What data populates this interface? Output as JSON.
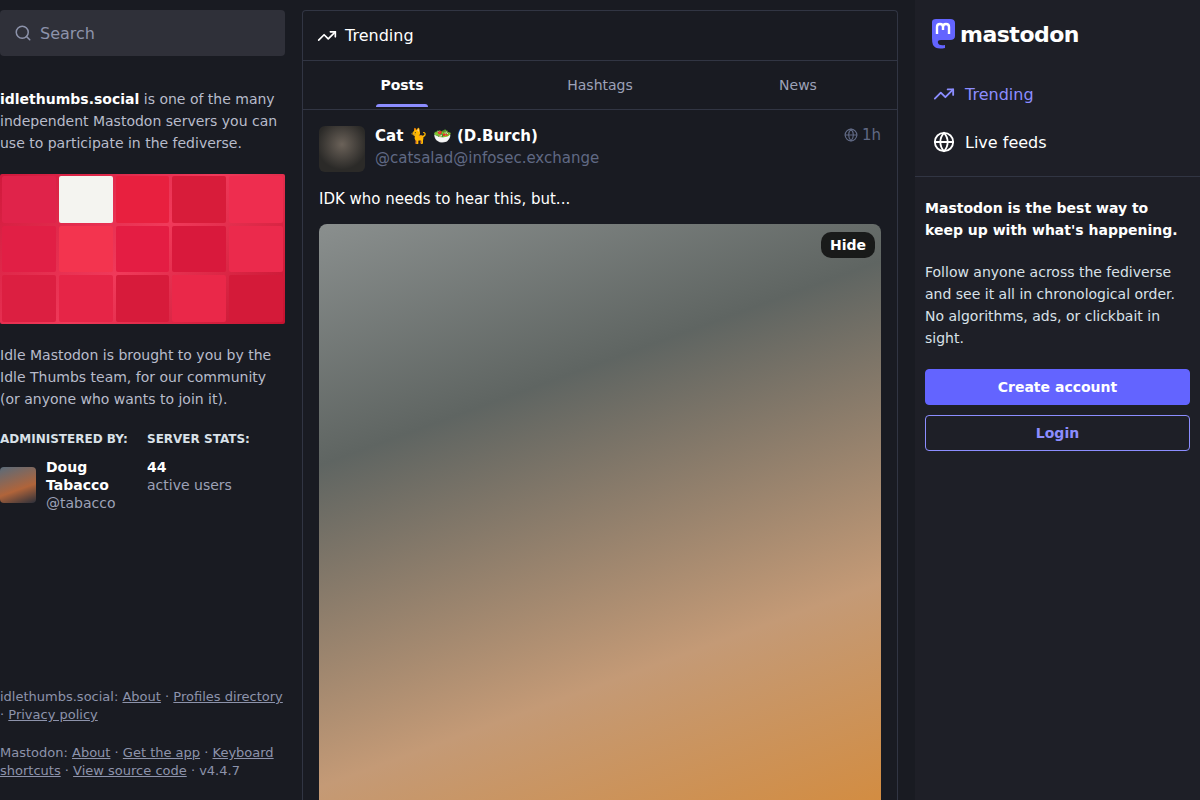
{
  "search": {
    "placeholder": "Search"
  },
  "server": {
    "name": "idlethumbs.social",
    "tagline": "is one of the many independent Mastodon servers you can use to participate in the fediverse.",
    "description": "Idle Mastodon is brought to you by the Idle Thumbs team, for our community (or anyone who wants to join it).",
    "admin": {
      "label": "ADMINISTERED BY:",
      "name": "Doug Tabacco",
      "handle": "@tabacco"
    },
    "stats": {
      "label": "SERVER STATS:",
      "count": "44",
      "unit": "active users"
    }
  },
  "footer": [
    {
      "label": "idlethumbs.social:",
      "links": [
        "About",
        "Profiles directory",
        "Privacy policy"
      ],
      "version": ""
    },
    {
      "label": "Mastodon:",
      "links": [
        "About",
        "Get the app",
        "Keyboard shortcuts",
        "View source code"
      ],
      "version": "v4.4.7"
    }
  ],
  "separator": "·",
  "column": {
    "title": "Trending"
  },
  "tabs": [
    {
      "label": "Posts",
      "selected": true
    },
    {
      "label": "Hashtags",
      "selected": false
    },
    {
      "label": "News",
      "selected": false
    }
  ],
  "posts": [
    {
      "name": "Cat 🐈 🥗 (D.Burch)",
      "handle": "@catsalad@infosec.exchange",
      "time": "1h",
      "content": "IDK who needs to hear this, but...",
      "media": {
        "hide_label": "Hide"
      }
    }
  ],
  "brand": {
    "name": "mastodon"
  },
  "nav": [
    {
      "label": "Trending",
      "selected": true
    },
    {
      "label": "Live feeds",
      "selected": false
    }
  ],
  "promo": {
    "title": "Mastodon is the best way to keep up with what's happening.",
    "text": "Follow anyone across the fediverse and see it all in chronological order. No algorithms, ads, or clickbait in sight.",
    "buttons": [
      {
        "label": "Create account",
        "kind": "primary"
      },
      {
        "label": "Login",
        "kind": "secondary"
      }
    ]
  }
}
